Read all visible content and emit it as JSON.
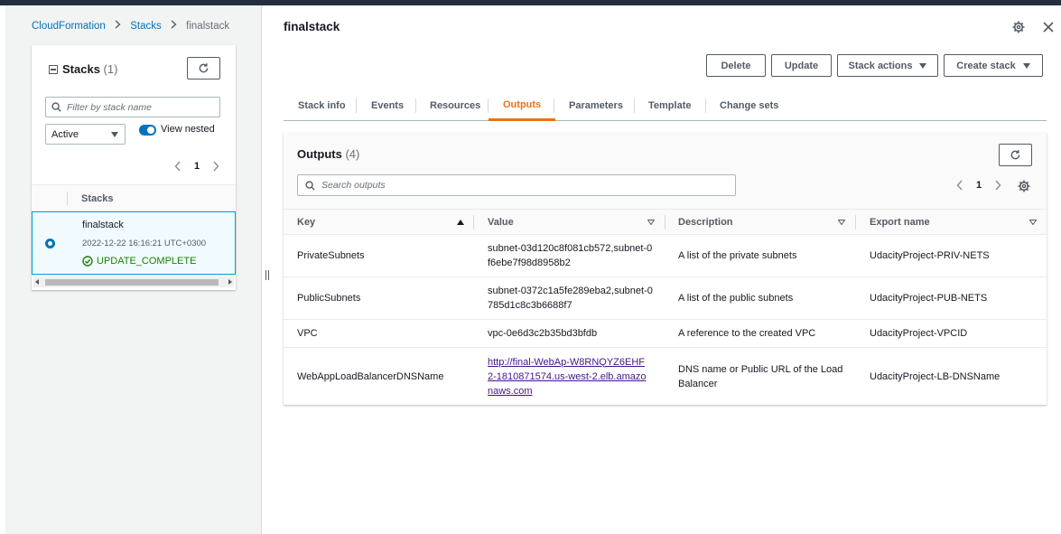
{
  "breadcrumb": {
    "items": [
      "CloudFormation",
      "Stacks"
    ],
    "current": "finalstack",
    "separator": ">"
  },
  "stacks_panel": {
    "title": "Stacks",
    "count": "(1)",
    "filter_placeholder": "Filter by stack name",
    "status_filter": "Active",
    "view_nested_label": "View nested",
    "view_nested_on": true,
    "page": "1",
    "column_header": "Stacks",
    "rows": [
      {
        "name": "finalstack",
        "timestamp": "2022-12-22 16:16:21 UTC+0300",
        "status": "UPDATE_COMPLETE",
        "selected": true
      }
    ]
  },
  "detail": {
    "title": "finalstack",
    "actions": {
      "delete": "Delete",
      "update": "Update",
      "stack_actions": "Stack actions",
      "create_stack": "Create stack"
    },
    "tabs": [
      "Stack info",
      "Events",
      "Resources",
      "Outputs",
      "Parameters",
      "Template",
      "Change sets"
    ],
    "active_tab": "Outputs"
  },
  "outputs": {
    "title": "Outputs",
    "count": "(4)",
    "search_placeholder": "Search outputs",
    "page": "1",
    "columns": [
      "Key",
      "Value",
      "Description",
      "Export name"
    ],
    "rows": [
      {
        "key": "PrivateSubnets",
        "value": "subnet-03d120c8f081cb572,subnet-0f6ebe7f98d8958b2",
        "description": "A list of the private subnets",
        "export_name": "UdacityProject-PRIV-NETS"
      },
      {
        "key": "PublicSubnets",
        "value": "subnet-0372c1a5fe289eba2,subnet-0785d1c8c3b6688f7",
        "description": "A list of the public subnets",
        "export_name": "UdacityProject-PUB-NETS"
      },
      {
        "key": "VPC",
        "value": "vpc-0e6d3c2b35bd3bfdb",
        "description": "A reference to the created VPC",
        "export_name": "UdacityProject-VPCID"
      },
      {
        "key": "WebAppLoadBalancerDNSName",
        "value": "http://final-WebAp-W8RNQYZ6EHF2-1810871574.us-west-2.elb.amazonaws.com",
        "description": "DNS name or Public URL of the Load Balancer",
        "export_name": "UdacityProject-LB-DNSName"
      }
    ]
  },
  "colors": {
    "link": "#0073bb",
    "active_tab": "#ec7211",
    "success": "#1d8102",
    "visited_link": "#44148c",
    "top_bar": "#232f3e"
  },
  "icons": {
    "refresh": "refresh-icon",
    "settings": "gear-icon",
    "close": "close-icon",
    "search": "search-icon",
    "success": "check-circle-icon"
  }
}
